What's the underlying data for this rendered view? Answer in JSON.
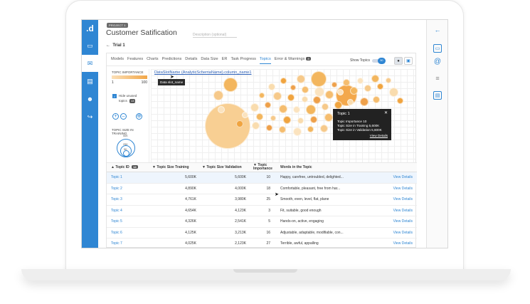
{
  "project_badge": "PROJECT 1",
  "page_title": "Customer Satification",
  "description_placeholder": "Description (optional)",
  "trial": "Trial 1",
  "logo": ".d",
  "tabs": [
    {
      "label": "Models"
    },
    {
      "label": "Features"
    },
    {
      "label": "Charts"
    },
    {
      "label": "Predictions"
    },
    {
      "label": "Details"
    },
    {
      "label": "Data Size"
    },
    {
      "label": "ER"
    },
    {
      "label": "Task Progress"
    },
    {
      "label": "Topics"
    },
    {
      "label": "Error & Warnings"
    }
  ],
  "error_count": "8",
  "show_topics": {
    "label": "Show Topics",
    "value": "50"
  },
  "controls": {
    "topic_importance_label": "TOPIC IMPORTANCE",
    "range_min": "1",
    "range_max": "100",
    "hide_unused_label": "Hide unused topics",
    "hide_unused_count": "13",
    "topic_size_label": "TOPIC SIZE IN TRAINING",
    "size_rings": [
      "50K",
      "25K",
      "5K"
    ]
  },
  "chart": {
    "datasource_link": "DataSlotName (AnalyticSchemaName).column_name1",
    "tooltip_small": "Data slot_name",
    "popup": {
      "title": "Topic 1",
      "importance": "Topic Importance  10",
      "size_training": "Topic Size in Training  5,600K",
      "size_validation": "Topic Size in Validation  5,600K",
      "link": "View Details"
    }
  },
  "table": {
    "headers": [
      "Topic ID",
      "Topic Size Training",
      "Topic Size Validation",
      "Topic Importance",
      "Words in the Topic"
    ],
    "topic_id_badge": "14",
    "rows": [
      {
        "id": "Topic 1",
        "train": "5,600K",
        "valid": "5,600K",
        "imp": "10",
        "words": "Happy, carefree, untroubled, delighted...",
        "link": "View Details"
      },
      {
        "id": "Topic 2",
        "train": "4,890K",
        "valid": "4,000K",
        "imp": "18",
        "words": "Comfortable, pleasant, free from har...",
        "link": "View Details"
      },
      {
        "id": "Topic 3",
        "train": "4,761K",
        "valid": "3,980K",
        "imp": "25",
        "words": "Smooth, even, level, flat, plane",
        "link": "View Details"
      },
      {
        "id": "Topic 4",
        "train": "4,654K",
        "valid": "4,123K",
        "imp": "3",
        "words": "Fit, suitable, good enough",
        "link": "View Details"
      },
      {
        "id": "Topic 5",
        "train": "4,326K",
        "valid": "2,541K",
        "imp": "5",
        "words": "Hands-on, active, engaging",
        "link": "View Details"
      },
      {
        "id": "Topic 6",
        "train": "4,125K",
        "valid": "3,213K",
        "imp": "16",
        "words": "Adjustable, adaptable, modifiable, con...",
        "link": "View Details"
      },
      {
        "id": "Topic 7",
        "train": "4,025K",
        "valid": "2,123K",
        "imp": "27",
        "words": "Terrible, awful, appalling",
        "link": "View Details"
      }
    ]
  }
}
